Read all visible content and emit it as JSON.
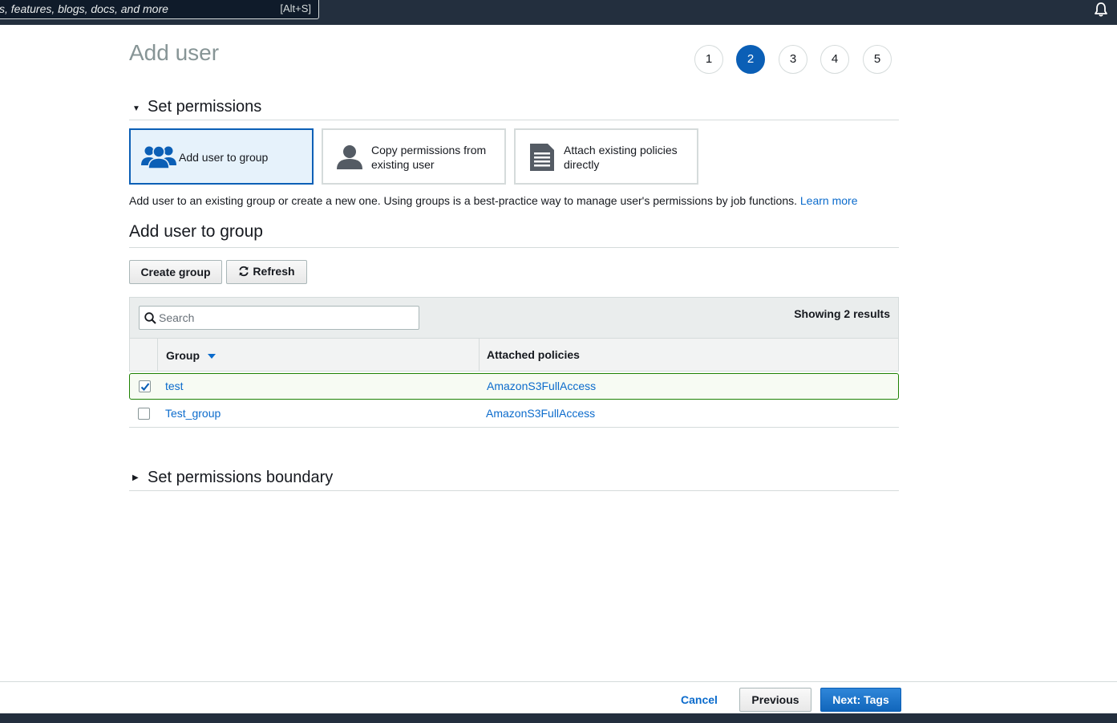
{
  "topbar": {
    "search_placeholder": "s, features, blogs, docs, and more",
    "search_shortcut": "[Alt+S]"
  },
  "page": {
    "title": "Add user"
  },
  "steps": [
    "1",
    "2",
    "3",
    "4",
    "5"
  ],
  "active_step": 2,
  "set_permissions": {
    "heading": "Set permissions",
    "options": [
      {
        "line1": "Add user to group",
        "line2": "",
        "icon": "users-icon",
        "selected": true
      },
      {
        "line1": "Copy permissions from",
        "line2": "existing user",
        "icon": "user-icon",
        "selected": false
      },
      {
        "line1": "Attach existing policies",
        "line2": "directly",
        "icon": "document-icon",
        "selected": false
      }
    ],
    "description": "Add user to an existing group or create a new one. Using groups is a best-practice way to manage user's permissions by job functions.",
    "learn_more": "Learn more"
  },
  "group_section": {
    "heading": "Add user to group",
    "create_group": "Create group",
    "refresh": "Refresh"
  },
  "table": {
    "search_placeholder": "Search",
    "showing": "Showing 2 results",
    "columns": [
      "Group",
      "Attached policies"
    ],
    "rows": [
      {
        "group": "test",
        "policies": "AmazonS3FullAccess",
        "checked": true
      },
      {
        "group": "Test_group",
        "policies": "AmazonS3FullAccess",
        "checked": false
      }
    ]
  },
  "boundary": {
    "heading": "Set permissions boundary"
  },
  "footer": {
    "cancel": "Cancel",
    "previous": "Previous",
    "next": "Next: Tags"
  },
  "colors": {
    "accent": "#0b5fb6",
    "link": "#0b6bcc",
    "topbar": "#232f3e",
    "selected_row_border": "#1d8102"
  }
}
